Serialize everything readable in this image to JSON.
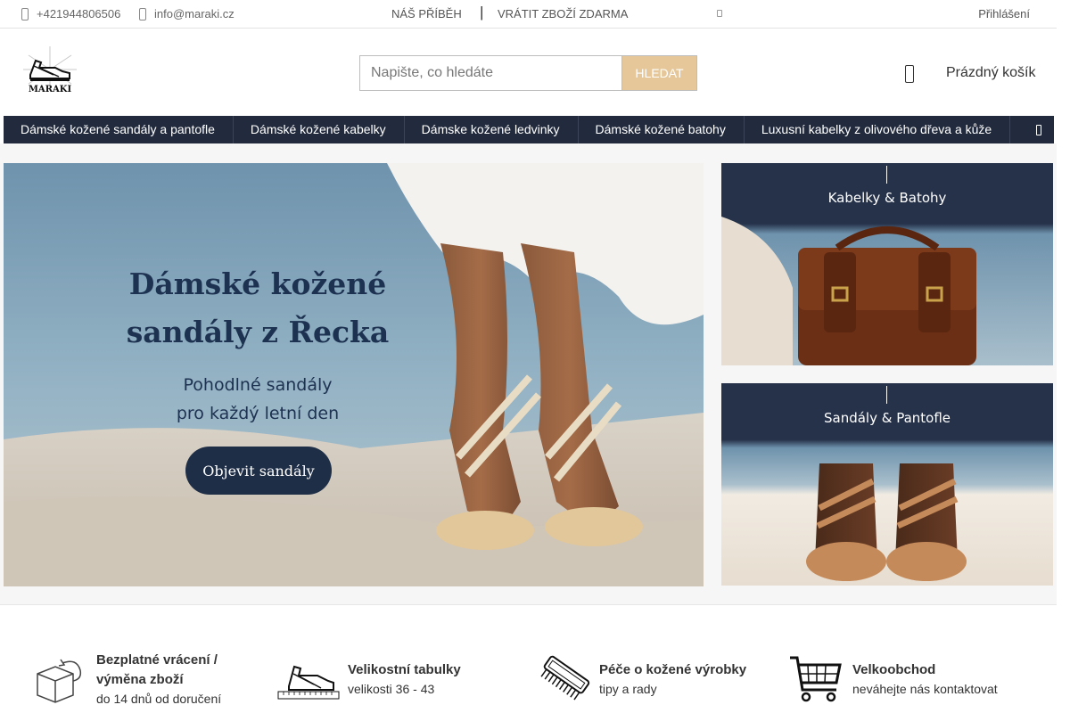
{
  "topbar": {
    "phone": "+421944806506",
    "email": "info@maraki.cz",
    "story": "NÁŠ PŘÍBĚH",
    "separator": "|",
    "returns": "VRÁTIT ZBOŽÍ ZDARMA",
    "login": "Přihlášení"
  },
  "logo": {
    "text": "MARAKI"
  },
  "search": {
    "placeholder": "Napište, co hledáte",
    "button": "HLEDAT"
  },
  "cart": {
    "label": "Prázdný košík"
  },
  "nav": {
    "items": [
      "Dámské kožené sandály a pantofle",
      "Dámské kožené kabelky",
      "Dámske kožené ledvinky",
      "Dámské kožené batohy",
      "Luxusní kabelky z olivového dřeva a kůže"
    ]
  },
  "hero": {
    "title_line1": "Dámské kožené",
    "title_line2": "sandály z Řecka",
    "sub_line1": "Pohodlné sandály",
    "sub_line2": "pro každý letní den",
    "button": "Objevit sandály"
  },
  "banners": {
    "bags": "Kabelky & Batohy",
    "sandals": "Sandály & Pantofle"
  },
  "features": [
    {
      "title": "Bezplatné vrácení / výměna zboží",
      "sub": "do 14 dnů od doručení",
      "icon": "box-return-icon"
    },
    {
      "title": "Velikostní tabulky",
      "sub": "velikosti 36 - 43",
      "icon": "sandal-ruler-icon"
    },
    {
      "title": "Péče o kožené výrobky",
      "sub": "tipy a rady",
      "icon": "brush-icon"
    },
    {
      "title": "Velkoobchod",
      "sub": "neváhejte nás kontaktovat",
      "icon": "cart-icon"
    }
  ],
  "colors": {
    "nav_bg": "#222b3d",
    "search_button": "#e5c79a",
    "hero_text": "#1d3150"
  }
}
